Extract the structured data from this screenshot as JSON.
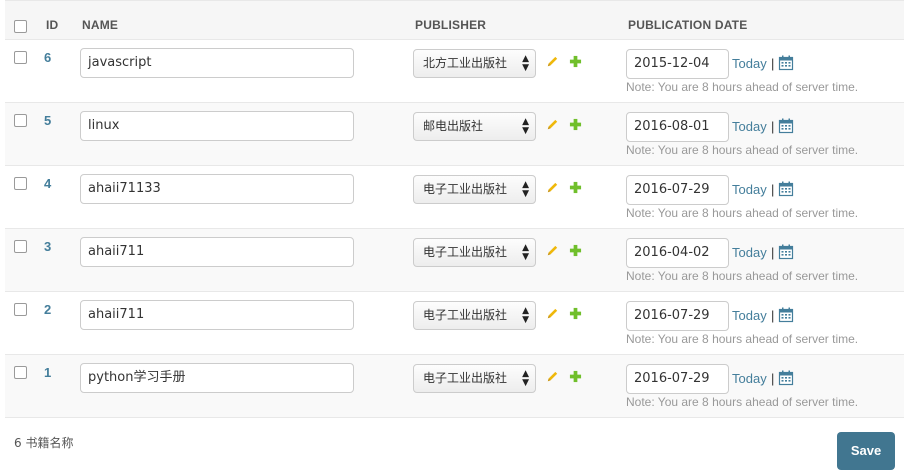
{
  "table": {
    "headers": {
      "id": "ID",
      "name": "NAME",
      "publisher": "PUBLISHER",
      "date": "PUBLICATION DATE"
    },
    "rows": [
      {
        "id": "6",
        "name": "javascript",
        "publisher": "北方工业出版社",
        "date": "2015-12-04",
        "selected": false
      },
      {
        "id": "5",
        "name": "linux",
        "publisher": "邮电出版社",
        "date": "2016-08-01",
        "selected": false
      },
      {
        "id": "4",
        "name": "ahaii71133",
        "publisher": "电子工业出版社",
        "date": "2016-07-29",
        "selected": false
      },
      {
        "id": "3",
        "name": "ahaii711",
        "publisher": "电子工业出版社",
        "date": "2016-04-02",
        "selected": false
      },
      {
        "id": "2",
        "name": "ahaii711",
        "publisher": "电子工业出版社",
        "date": "2016-07-29",
        "selected": false
      },
      {
        "id": "1",
        "name": "python学习手册",
        "publisher": "电子工业出版社",
        "date": "2016-07-29",
        "selected": false
      }
    ],
    "today_label": "Today",
    "separator": "|",
    "tz_note": "Note: You are 8 hours ahead of server time."
  },
  "footer": {
    "count_text": "6 书籍名称",
    "save_label": "Save"
  },
  "colors": {
    "link": "#447e9b",
    "save_bg": "#417690",
    "edit_icon": "#efb80b",
    "add_icon": "#70bf2b",
    "calendar_icon": "#447e9b"
  },
  "icons": {
    "edit": "pencil-icon",
    "add": "plus-icon",
    "calendar": "calendar-icon",
    "select_arrow": "updown-arrows-icon"
  }
}
